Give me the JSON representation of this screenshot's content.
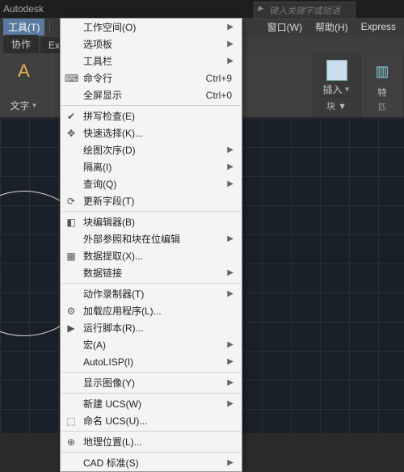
{
  "titlebar": {
    "product": "Autodesk"
  },
  "search": {
    "placeholder": "键入关键字或短语"
  },
  "menubar": {
    "active": "工具(T)",
    "right": [
      "窗口(W)",
      "帮助(H)",
      "Express"
    ]
  },
  "tabstrip": {
    "left": "协作",
    "right": "Exp"
  },
  "ribbon": {
    "text": {
      "label": "文字",
      "caret": "▼"
    },
    "insert": {
      "label": "插入",
      "caret": "▼"
    },
    "feature": {
      "label": "特",
      "sub": "匹"
    },
    "block_panel": "块 ▼"
  },
  "menu": [
    {
      "type": "item",
      "label": "工作空间(O)",
      "submenu": true
    },
    {
      "type": "item",
      "label": "选项板",
      "submenu": true
    },
    {
      "type": "item",
      "label": "工具栏",
      "submenu": true
    },
    {
      "type": "item",
      "icon": "⌨",
      "label": "命令行",
      "shortcut": "Ctrl+9"
    },
    {
      "type": "item",
      "label": "全屏显示",
      "shortcut": "Ctrl+0"
    },
    {
      "type": "sep"
    },
    {
      "type": "item",
      "icon": "✔",
      "label": "拼写检查(E)"
    },
    {
      "type": "item",
      "icon": "✥",
      "label": "快速选择(K)..."
    },
    {
      "type": "item",
      "label": "绘图次序(D)",
      "submenu": true
    },
    {
      "type": "item",
      "label": "隔离(I)",
      "submenu": true
    },
    {
      "type": "item",
      "label": "查询(Q)",
      "submenu": true
    },
    {
      "type": "item",
      "icon": "⟳",
      "label": "更新字段(T)"
    },
    {
      "type": "sep"
    },
    {
      "type": "item",
      "icon": "◧",
      "label": "块编辑器(B)"
    },
    {
      "type": "item",
      "label": "外部参照和块在位编辑",
      "submenu": true
    },
    {
      "type": "item",
      "icon": "▦",
      "label": "数据提取(X)..."
    },
    {
      "type": "item",
      "label": "数据链接",
      "submenu": true
    },
    {
      "type": "sep"
    },
    {
      "type": "item",
      "label": "动作录制器(T)",
      "submenu": true
    },
    {
      "type": "item",
      "icon": "⚙",
      "label": "加载应用程序(L)..."
    },
    {
      "type": "item",
      "icon": "▶",
      "label": "运行脚本(R)..."
    },
    {
      "type": "item",
      "label": "宏(A)",
      "submenu": true
    },
    {
      "type": "item",
      "label": "AutoLISP(I)",
      "submenu": true
    },
    {
      "type": "sep"
    },
    {
      "type": "item",
      "label": "显示图像(Y)",
      "submenu": true
    },
    {
      "type": "sep"
    },
    {
      "type": "item",
      "label": "新建 UCS(W)",
      "submenu": true
    },
    {
      "type": "item",
      "icon": "⬚",
      "label": "命名 UCS(U)..."
    },
    {
      "type": "sep"
    },
    {
      "type": "item",
      "icon": "⊕",
      "label": "地理位置(L)..."
    },
    {
      "type": "sep"
    },
    {
      "type": "item",
      "label": "CAD 标准(S)",
      "submenu": true
    }
  ]
}
